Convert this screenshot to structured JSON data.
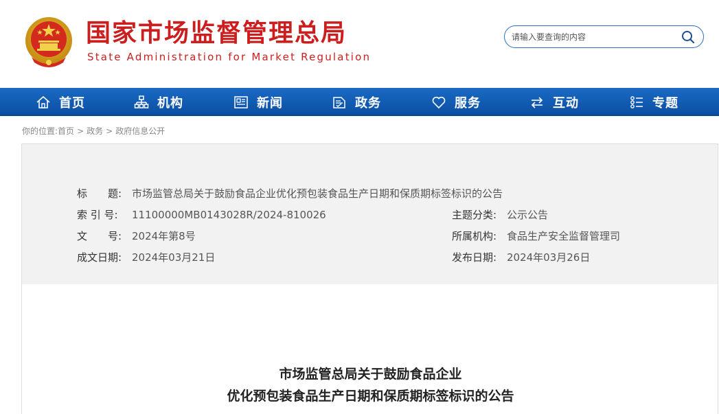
{
  "header": {
    "title": "国家市场监督管理总局",
    "subtitle": "State Administration for Market Regulation",
    "search": {
      "placeholder": "请输入要查询的内容",
      "value": ""
    }
  },
  "nav": {
    "items": [
      {
        "label": "首页",
        "icon": "home-icon"
      },
      {
        "label": "机构",
        "icon": "org-chart-icon"
      },
      {
        "label": "新闻",
        "icon": "news-icon"
      },
      {
        "label": "政务",
        "icon": "government-affairs-icon"
      },
      {
        "label": "服务",
        "icon": "heart-icon"
      },
      {
        "label": "互动",
        "icon": "exchange-arrows-icon"
      },
      {
        "label": "专题",
        "icon": "topics-icon"
      }
    ]
  },
  "breadcrumb": {
    "prefix": "你的位置:",
    "items": [
      "首页",
      "政务",
      "政府信息公开"
    ],
    "separator": ">"
  },
  "info": {
    "title_label": "标　　题:",
    "title_value": "市场监管总局关于鼓励食品企业优化预包装食品生产日期和保质期标签标识的公告",
    "index_label": "索 引 号:",
    "index_value": "11100000MB0143028R/2024-810026",
    "category_label": "主题分类:",
    "category_value": "公示公告",
    "docno_label": "文　　号:",
    "docno_value": "2024年第8号",
    "org_label": "所属机构:",
    "org_value": "食品生产安全监督管理司",
    "created_label": "成文日期:",
    "created_value": "2024年03月21日",
    "published_label": "发布日期:",
    "published_value": "2024年03月26日"
  },
  "document": {
    "title_line1": "市场监管总局关于鼓励食品企业",
    "title_line2": "优化预包装食品生产日期和保质期标签标识的公告"
  },
  "colors": {
    "brand_red": "#cc1e1e",
    "nav_blue": "#0b4fa3",
    "search_border": "#2b6cc4"
  }
}
